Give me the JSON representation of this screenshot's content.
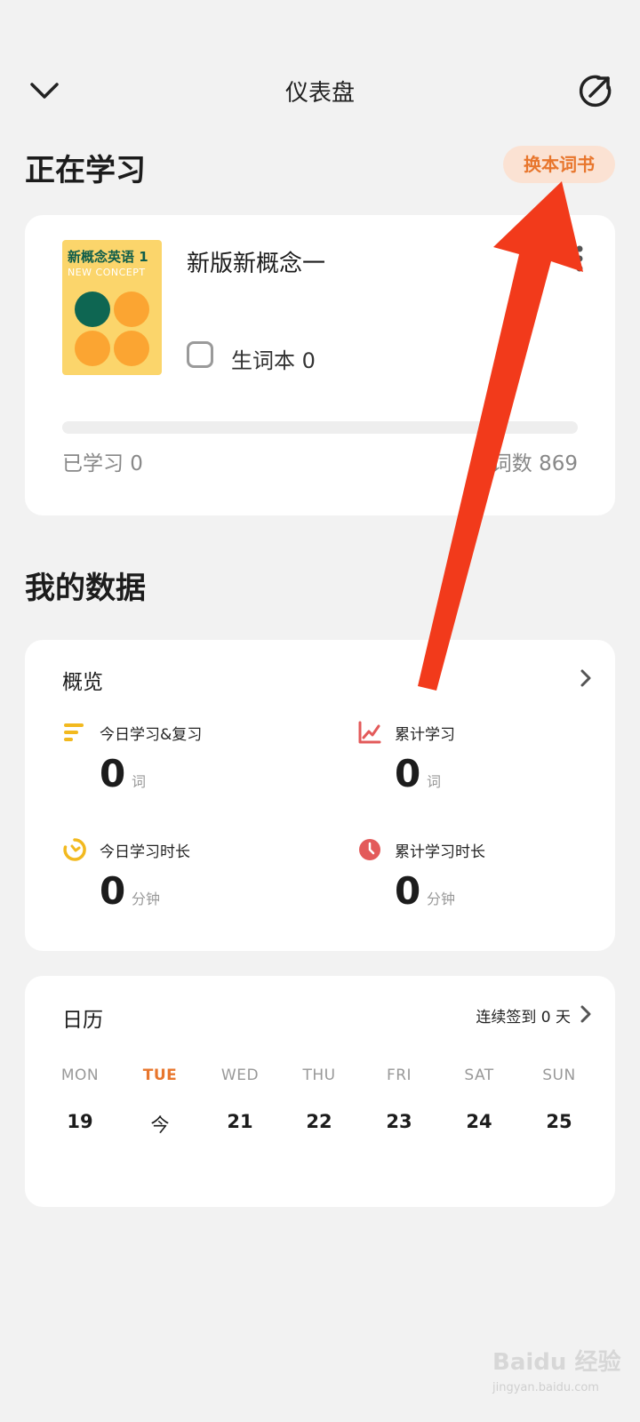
{
  "header": {
    "title": "仪表盘"
  },
  "studying": {
    "section_title": "正在学习",
    "switch_button": "换本词书",
    "book": {
      "cover_title": "新概念英语 1",
      "cover_subtitle": "NEW CONCEPT",
      "name": "新版新概念一",
      "vocab_label": "生词本 0",
      "learned_label": "已学习 0",
      "total_label": "总词数 869",
      "progress_fraction": 0
    }
  },
  "my_data": {
    "section_title": "我的数据",
    "overview": {
      "title": "概览",
      "stats": [
        {
          "label": "今日学习&复习",
          "value": "0",
          "unit": "词",
          "icon": "bars-icon",
          "color": "#f2b91f"
        },
        {
          "label": "累计学习",
          "value": "0",
          "unit": "词",
          "icon": "line-chart-icon",
          "color": "#e35a5a"
        },
        {
          "label": "今日学习时长",
          "value": "0",
          "unit": "分钟",
          "icon": "timer-icon",
          "color": "#f2b91f"
        },
        {
          "label": "累计学习时长",
          "value": "0",
          "unit": "分钟",
          "icon": "clock-icon",
          "color": "#e35a5a"
        }
      ]
    },
    "calendar": {
      "title": "日历",
      "streak": "连续签到 0 天",
      "weekdays": [
        "MON",
        "TUE",
        "WED",
        "THU",
        "FRI",
        "SAT",
        "SUN"
      ],
      "days": [
        "19",
        "今",
        "21",
        "22",
        "23",
        "24",
        "25"
      ],
      "today_index": 1
    }
  },
  "annotation": {
    "color": "#f23a1b"
  },
  "watermark": {
    "text": "Baidu 经验",
    "sub": "jingyan.baidu.com"
  },
  "colors": {
    "accent": "#e8762d",
    "background": "#f2f2f2"
  }
}
